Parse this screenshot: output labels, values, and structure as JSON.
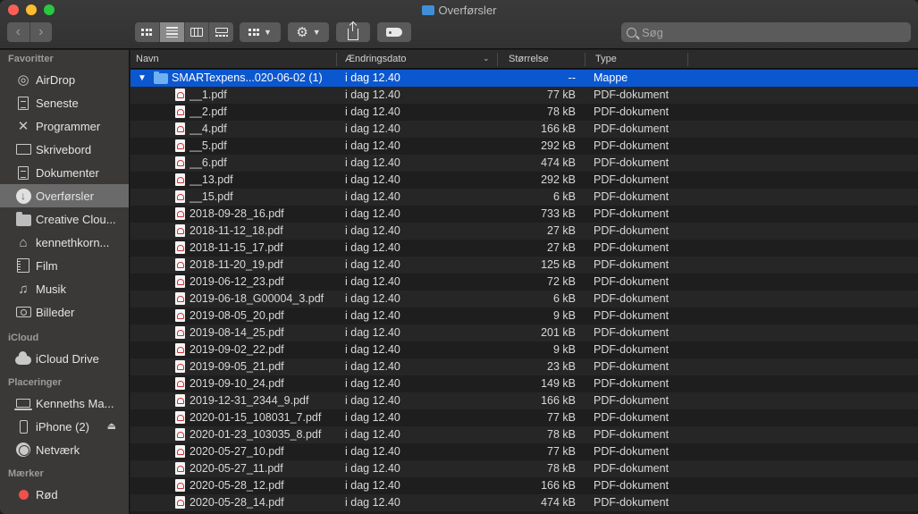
{
  "window": {
    "title": "Overførsler"
  },
  "toolbar": {
    "back": "‹",
    "forward": "›",
    "search_placeholder": "Søg"
  },
  "sidebar": {
    "sections": [
      {
        "label": "Favoritter",
        "items": [
          {
            "label": "AirDrop",
            "icon": "airdrop-icon"
          },
          {
            "label": "Seneste",
            "icon": "recents-icon"
          },
          {
            "label": "Programmer",
            "icon": "applications-icon"
          },
          {
            "label": "Skrivebord",
            "icon": "desktop-icon"
          },
          {
            "label": "Dokumenter",
            "icon": "documents-icon"
          },
          {
            "label": "Overførsler",
            "icon": "downloads-icon",
            "active": true
          },
          {
            "label": "Creative Clou...",
            "icon": "folder-icon"
          },
          {
            "label": "kennethkorn...",
            "icon": "home-icon"
          },
          {
            "label": "Film",
            "icon": "movies-icon"
          },
          {
            "label": "Musik",
            "icon": "music-icon"
          },
          {
            "label": "Billeder",
            "icon": "pictures-icon"
          }
        ]
      },
      {
        "label": "iCloud",
        "items": [
          {
            "label": "iCloud Drive",
            "icon": "icloud-icon"
          }
        ]
      },
      {
        "label": "Placeringer",
        "items": [
          {
            "label": "Kenneths Ma...",
            "icon": "laptop-icon"
          },
          {
            "label": "iPhone (2)",
            "icon": "iphone-icon",
            "eject": true
          },
          {
            "label": "Netværk",
            "icon": "network-icon"
          }
        ]
      },
      {
        "label": "Mærker",
        "items": [
          {
            "label": "Rød",
            "icon": "red-tag-icon"
          }
        ]
      }
    ]
  },
  "columns": {
    "name": "Navn",
    "date": "Ændringsdato",
    "size": "Størrelse",
    "kind": "Type"
  },
  "folder": {
    "name": "SMARTexpens...020-06-02 (1)",
    "date": "i dag 12.40",
    "size": "--",
    "kind": "Mappe"
  },
  "files": [
    {
      "name": "__1.pdf",
      "date": "i dag 12.40",
      "size": "77 kB",
      "kind": "PDF-dokument"
    },
    {
      "name": "__2.pdf",
      "date": "i dag 12.40",
      "size": "78 kB",
      "kind": "PDF-dokument"
    },
    {
      "name": "__4.pdf",
      "date": "i dag 12.40",
      "size": "166 kB",
      "kind": "PDF-dokument"
    },
    {
      "name": "__5.pdf",
      "date": "i dag 12.40",
      "size": "292 kB",
      "kind": "PDF-dokument"
    },
    {
      "name": "__6.pdf",
      "date": "i dag 12.40",
      "size": "474 kB",
      "kind": "PDF-dokument"
    },
    {
      "name": "__13.pdf",
      "date": "i dag 12.40",
      "size": "292 kB",
      "kind": "PDF-dokument"
    },
    {
      "name": "__15.pdf",
      "date": "i dag 12.40",
      "size": "6 kB",
      "kind": "PDF-dokument"
    },
    {
      "name": "2018-09-28_16.pdf",
      "date": "i dag 12.40",
      "size": "733 kB",
      "kind": "PDF-dokument"
    },
    {
      "name": "2018-11-12_18.pdf",
      "date": "i dag 12.40",
      "size": "27 kB",
      "kind": "PDF-dokument"
    },
    {
      "name": "2018-11-15_17.pdf",
      "date": "i dag 12.40",
      "size": "27 kB",
      "kind": "PDF-dokument"
    },
    {
      "name": "2018-11-20_19.pdf",
      "date": "i dag 12.40",
      "size": "125 kB",
      "kind": "PDF-dokument"
    },
    {
      "name": "2019-06-12_23.pdf",
      "date": "i dag 12.40",
      "size": "72 kB",
      "kind": "PDF-dokument"
    },
    {
      "name": "2019-06-18_G00004_3.pdf",
      "date": "i dag 12.40",
      "size": "6 kB",
      "kind": "PDF-dokument"
    },
    {
      "name": "2019-08-05_20.pdf",
      "date": "i dag 12.40",
      "size": "9 kB",
      "kind": "PDF-dokument"
    },
    {
      "name": "2019-08-14_25.pdf",
      "date": "i dag 12.40",
      "size": "201 kB",
      "kind": "PDF-dokument"
    },
    {
      "name": "2019-09-02_22.pdf",
      "date": "i dag 12.40",
      "size": "9 kB",
      "kind": "PDF-dokument"
    },
    {
      "name": "2019-09-05_21.pdf",
      "date": "i dag 12.40",
      "size": "23 kB",
      "kind": "PDF-dokument"
    },
    {
      "name": "2019-09-10_24.pdf",
      "date": "i dag 12.40",
      "size": "149 kB",
      "kind": "PDF-dokument"
    },
    {
      "name": "2019-12-31_2344_9.pdf",
      "date": "i dag 12.40",
      "size": "166 kB",
      "kind": "PDF-dokument"
    },
    {
      "name": "2020-01-15_108031_7.pdf",
      "date": "i dag 12.40",
      "size": "77 kB",
      "kind": "PDF-dokument"
    },
    {
      "name": "2020-01-23_103035_8.pdf",
      "date": "i dag 12.40",
      "size": "78 kB",
      "kind": "PDF-dokument"
    },
    {
      "name": "2020-05-27_10.pdf",
      "date": "i dag 12.40",
      "size": "77 kB",
      "kind": "PDF-dokument"
    },
    {
      "name": "2020-05-27_11.pdf",
      "date": "i dag 12.40",
      "size": "78 kB",
      "kind": "PDF-dokument"
    },
    {
      "name": "2020-05-28_12.pdf",
      "date": "i dag 12.40",
      "size": "166 kB",
      "kind": "PDF-dokument"
    },
    {
      "name": "2020-05-28_14.pdf",
      "date": "i dag 12.40",
      "size": "474 kB",
      "kind": "PDF-dokument"
    }
  ]
}
